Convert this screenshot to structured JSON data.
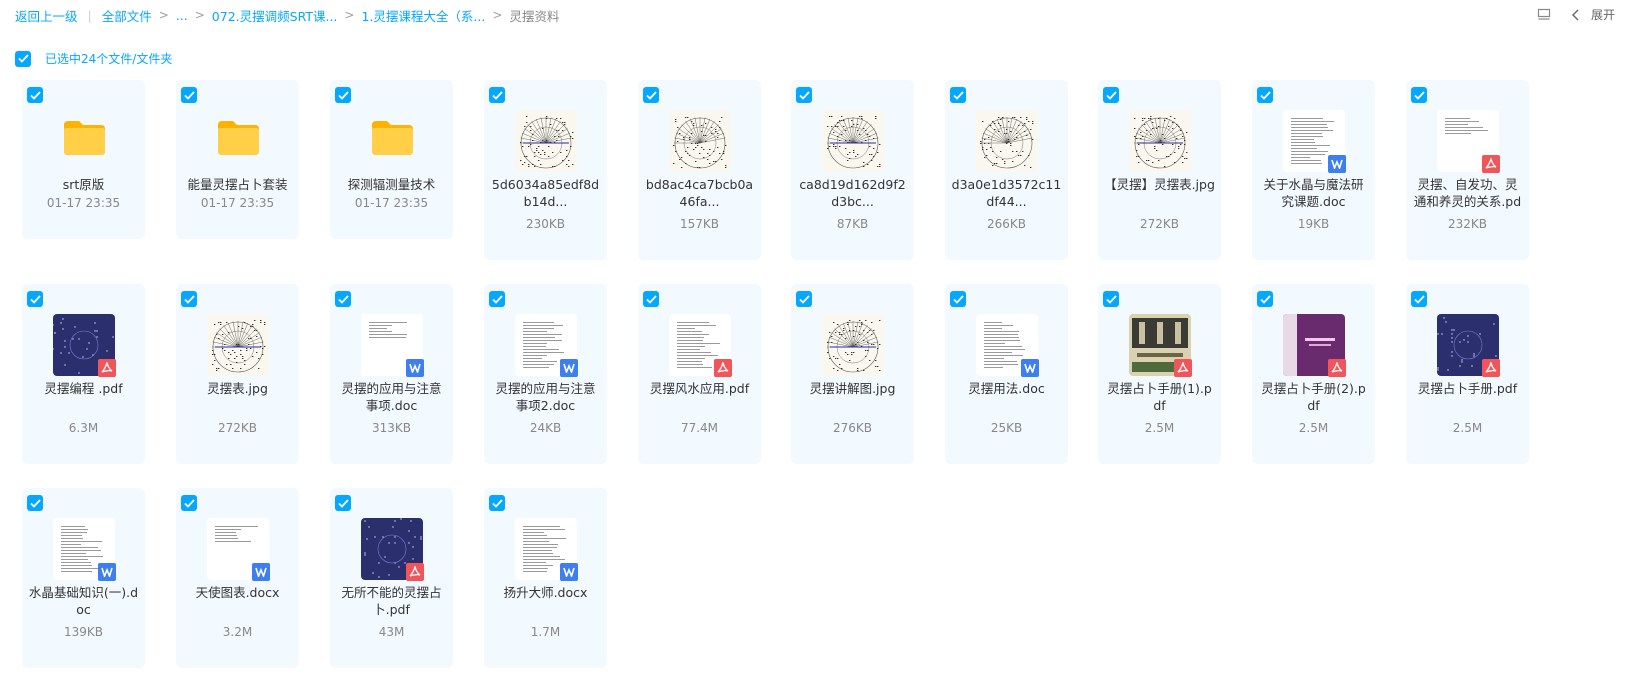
{
  "breadcrumb": {
    "back": "返回上一级",
    "all_files": "全部文件",
    "ellipsis": "...",
    "folder1": "072.灵摆调频SRT课...",
    "folder2": "1.灵摆课程大全（系...",
    "current": "灵摆资料"
  },
  "toolbar": {
    "expand_label": "展开",
    "list_view_icon": "list-view-icon",
    "collapse_icon": "chevron-left-icon"
  },
  "selection": {
    "text": "已选中24个文件/文件夹",
    "checked": true
  },
  "colors": {
    "accent": "#06a7ff",
    "tile_bg": "#f2f9ff",
    "folder": "#ffc53d",
    "doc_badge": "#3d7ff0",
    "pdf_badge": "#f0555a"
  },
  "files": [
    {
      "name": "srt原版",
      "meta": "01-17 23:35",
      "type": "folder",
      "thumb": "folder-icon"
    },
    {
      "name": "能量灵摆占卜套装",
      "meta": "01-17 23:35",
      "type": "folder",
      "thumb": "folder-icon"
    },
    {
      "name": "探测辐测量技术",
      "meta": "01-17 23:35",
      "type": "folder",
      "thumb": "folder-icon"
    },
    {
      "name": "5d6034a85edf8db14d...",
      "meta": "230KB",
      "type": "image",
      "thumb": "chart-image"
    },
    {
      "name": "bd8ac4ca7bcb0a46fa...",
      "meta": "157KB",
      "type": "image",
      "thumb": "chart-image"
    },
    {
      "name": "ca8d19d162d9f2d3bc...",
      "meta": "87KB",
      "type": "image",
      "thumb": "chart-image"
    },
    {
      "name": "d3a0e1d3572c11df44...",
      "meta": "266KB",
      "type": "image",
      "thumb": "chart-image"
    },
    {
      "name": "【灵摆】灵摆表.jpg",
      "meta": "272KB",
      "type": "image",
      "thumb": "chart-image"
    },
    {
      "name": "关于水晶与魔法研究课题.doc",
      "meta": "19KB",
      "type": "doc",
      "thumb": "document-image"
    },
    {
      "name": "灵摆、自发功、灵通和养灵的关系.pd",
      "meta": "232KB",
      "type": "pdf",
      "thumb": "document-image"
    },
    {
      "name": "灵摆编程 .pdf",
      "meta": "6.3M",
      "type": "pdf",
      "thumb": "cover-image"
    },
    {
      "name": "灵摆表.jpg",
      "meta": "272KB",
      "type": "image",
      "thumb": "chart-image"
    },
    {
      "name": "灵摆的应用与注意事项.doc",
      "meta": "313KB",
      "type": "doc",
      "thumb": "document-image"
    },
    {
      "name": "灵摆的应用与注意事项2.doc",
      "meta": "24KB",
      "type": "doc",
      "thumb": "document-image"
    },
    {
      "name": "灵摆风水应用.pdf",
      "meta": "77.4M",
      "type": "pdf",
      "thumb": "document-image"
    },
    {
      "name": "灵摆讲解图.jpg",
      "meta": "276KB",
      "type": "image",
      "thumb": "chart-image"
    },
    {
      "name": "灵摆用法.doc",
      "meta": "25KB",
      "type": "doc",
      "thumb": "document-image"
    },
    {
      "name": "灵摆占卜手册(1).pdf",
      "meta": "2.5M",
      "type": "pdf",
      "thumb": "cover-image"
    },
    {
      "name": "灵摆占卜手册(2).pdf",
      "meta": "2.5M",
      "type": "pdf",
      "thumb": "cover-image"
    },
    {
      "name": "灵摆占卜手册.pdf",
      "meta": "2.5M",
      "type": "pdf",
      "thumb": "cover-image"
    },
    {
      "name": "水晶基础知识(一).doc",
      "meta": "139KB",
      "type": "doc",
      "thumb": "document-image"
    },
    {
      "name": "天使图表.docx",
      "meta": "3.2M",
      "type": "doc",
      "thumb": "document-image"
    },
    {
      "name": "无所不能的灵摆占卜.pdf",
      "meta": "43M",
      "type": "pdf",
      "thumb": "cover-image"
    },
    {
      "name": "扬升大师.docx",
      "meta": "1.7M",
      "type": "doc",
      "thumb": "document-image"
    }
  ]
}
